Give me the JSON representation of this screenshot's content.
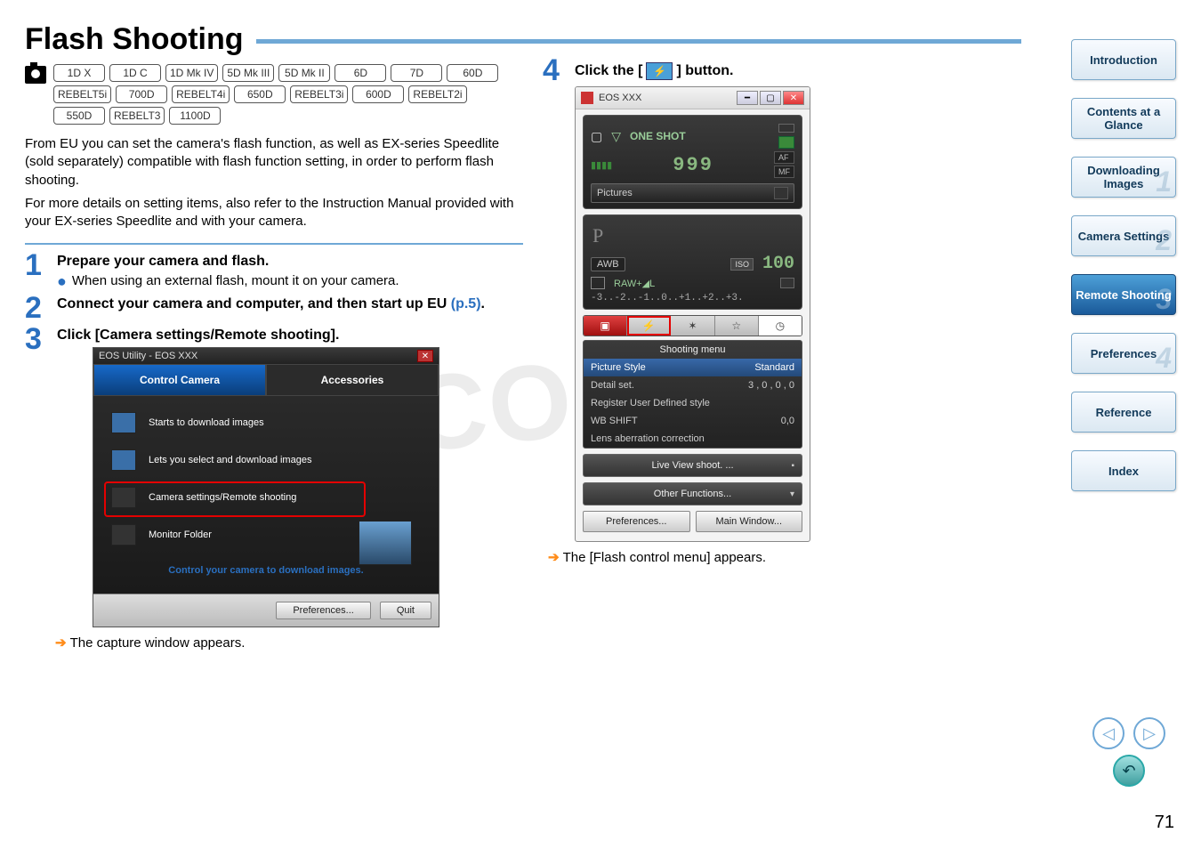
{
  "title": "Flash Shooting",
  "camera_badges": [
    "1D X",
    "1D C",
    "1D Mk IV",
    "5D Mk III",
    "5D Mk II",
    "6D",
    "7D",
    "60D",
    "REBELT5i",
    "700D",
    "REBELT4i",
    "650D",
    "REBELT3i",
    "600D",
    "REBELT2i",
    "550D",
    "REBELT3",
    "1100D"
  ],
  "intro": {
    "p1": "From EU you can set the camera's flash function, as well as EX-series Speedlite (sold separately) compatible with flash function setting, in order to perform flash shooting.",
    "p2": "For more details on setting items, also refer to the Instruction Manual provided with your EX-series Speedlite and with your camera."
  },
  "steps": {
    "s1": {
      "num": "1",
      "title": "Prepare your camera and flash.",
      "bullet": "When using an external flash, mount it on your camera."
    },
    "s2": {
      "num": "2",
      "title_a": "Connect your camera and computer, and then start up EU ",
      "link": "(p.5)",
      "title_b": "."
    },
    "s3": {
      "num": "3",
      "title": "Click [Camera settings/Remote shooting]."
    },
    "s3_note": "The capture window appears.",
    "s4": {
      "num": "4",
      "title_a": "Click the [ ",
      "title_b": " ] button."
    },
    "s4_note": "The [Flash control menu] appears."
  },
  "eos_utility": {
    "title": "EOS Utility - EOS XXX",
    "tab_control": "Control Camera",
    "tab_accessories": "Accessories",
    "item_download": "Starts to download images",
    "item_select": "Lets you select and download images",
    "item_settings": "Camera settings/Remote shooting",
    "item_monitor": "Monitor Folder",
    "footer": "Control your camera to download images.",
    "btn_prefs": "Preferences...",
    "btn_quit": "Quit"
  },
  "capture": {
    "title": "EOS XXX",
    "one_shot": "ONE SHOT",
    "af": "AF",
    "mf": "MF",
    "shots": "999",
    "pictures": "Pictures",
    "mode": "P",
    "awb": "AWB",
    "iso_label": "ISO",
    "iso": "100",
    "raw": "RAW+◢L",
    "exp": "-3..-2..-1..0..+1..+2..+3.",
    "menu_title": "Shooting menu",
    "menu": [
      {
        "k": "Picture Style",
        "v": "Standard"
      },
      {
        "k": "Detail set.",
        "v": "3 , 0 , 0 , 0"
      },
      {
        "k": "Register User Defined style",
        "v": ""
      },
      {
        "k": "WB SHIFT",
        "v": "0,0"
      },
      {
        "k": "Lens aberration correction",
        "v": ""
      }
    ],
    "live_view": "Live View shoot. ...",
    "other_fn": "Other Functions...",
    "prefs": "Preferences...",
    "main_win": "Main Window..."
  },
  "sidebar": [
    {
      "label": "Introduction",
      "num": "",
      "active": false
    },
    {
      "label": "Contents at a Glance",
      "num": "",
      "active": false
    },
    {
      "label": "Downloading Images",
      "num": "1",
      "active": false
    },
    {
      "label": "Camera Settings",
      "num": "2",
      "active": false
    },
    {
      "label": "Remote Shooting",
      "num": "3",
      "active": true
    },
    {
      "label": "Preferences",
      "num": "4",
      "active": false
    },
    {
      "label": "Reference",
      "num": "",
      "active": false
    },
    {
      "label": "Index",
      "num": "",
      "active": false
    }
  ],
  "page_number": "71",
  "watermark": "COPY"
}
